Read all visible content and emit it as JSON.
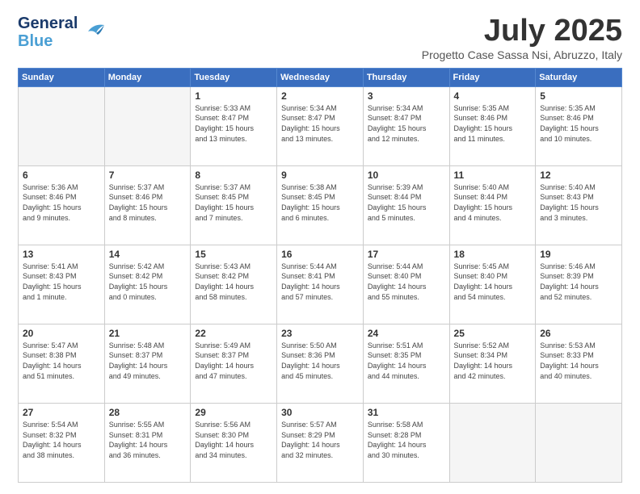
{
  "logo": {
    "line1": "General",
    "line2": "Blue"
  },
  "header": {
    "month": "July 2025",
    "subtitle": "Progetto Case Sassa Nsi, Abruzzo, Italy"
  },
  "weekdays": [
    "Sunday",
    "Monday",
    "Tuesday",
    "Wednesday",
    "Thursday",
    "Friday",
    "Saturday"
  ],
  "weeks": [
    [
      {
        "day": "",
        "info": ""
      },
      {
        "day": "",
        "info": ""
      },
      {
        "day": "1",
        "info": "Sunrise: 5:33 AM\nSunset: 8:47 PM\nDaylight: 15 hours\nand 13 minutes."
      },
      {
        "day": "2",
        "info": "Sunrise: 5:34 AM\nSunset: 8:47 PM\nDaylight: 15 hours\nand 13 minutes."
      },
      {
        "day": "3",
        "info": "Sunrise: 5:34 AM\nSunset: 8:47 PM\nDaylight: 15 hours\nand 12 minutes."
      },
      {
        "day": "4",
        "info": "Sunrise: 5:35 AM\nSunset: 8:46 PM\nDaylight: 15 hours\nand 11 minutes."
      },
      {
        "day": "5",
        "info": "Sunrise: 5:35 AM\nSunset: 8:46 PM\nDaylight: 15 hours\nand 10 minutes."
      }
    ],
    [
      {
        "day": "6",
        "info": "Sunrise: 5:36 AM\nSunset: 8:46 PM\nDaylight: 15 hours\nand 9 minutes."
      },
      {
        "day": "7",
        "info": "Sunrise: 5:37 AM\nSunset: 8:46 PM\nDaylight: 15 hours\nand 8 minutes."
      },
      {
        "day": "8",
        "info": "Sunrise: 5:37 AM\nSunset: 8:45 PM\nDaylight: 15 hours\nand 7 minutes."
      },
      {
        "day": "9",
        "info": "Sunrise: 5:38 AM\nSunset: 8:45 PM\nDaylight: 15 hours\nand 6 minutes."
      },
      {
        "day": "10",
        "info": "Sunrise: 5:39 AM\nSunset: 8:44 PM\nDaylight: 15 hours\nand 5 minutes."
      },
      {
        "day": "11",
        "info": "Sunrise: 5:40 AM\nSunset: 8:44 PM\nDaylight: 15 hours\nand 4 minutes."
      },
      {
        "day": "12",
        "info": "Sunrise: 5:40 AM\nSunset: 8:43 PM\nDaylight: 15 hours\nand 3 minutes."
      }
    ],
    [
      {
        "day": "13",
        "info": "Sunrise: 5:41 AM\nSunset: 8:43 PM\nDaylight: 15 hours\nand 1 minute."
      },
      {
        "day": "14",
        "info": "Sunrise: 5:42 AM\nSunset: 8:42 PM\nDaylight: 15 hours\nand 0 minutes."
      },
      {
        "day": "15",
        "info": "Sunrise: 5:43 AM\nSunset: 8:42 PM\nDaylight: 14 hours\nand 58 minutes."
      },
      {
        "day": "16",
        "info": "Sunrise: 5:44 AM\nSunset: 8:41 PM\nDaylight: 14 hours\nand 57 minutes."
      },
      {
        "day": "17",
        "info": "Sunrise: 5:44 AM\nSunset: 8:40 PM\nDaylight: 14 hours\nand 55 minutes."
      },
      {
        "day": "18",
        "info": "Sunrise: 5:45 AM\nSunset: 8:40 PM\nDaylight: 14 hours\nand 54 minutes."
      },
      {
        "day": "19",
        "info": "Sunrise: 5:46 AM\nSunset: 8:39 PM\nDaylight: 14 hours\nand 52 minutes."
      }
    ],
    [
      {
        "day": "20",
        "info": "Sunrise: 5:47 AM\nSunset: 8:38 PM\nDaylight: 14 hours\nand 51 minutes."
      },
      {
        "day": "21",
        "info": "Sunrise: 5:48 AM\nSunset: 8:37 PM\nDaylight: 14 hours\nand 49 minutes."
      },
      {
        "day": "22",
        "info": "Sunrise: 5:49 AM\nSunset: 8:37 PM\nDaylight: 14 hours\nand 47 minutes."
      },
      {
        "day": "23",
        "info": "Sunrise: 5:50 AM\nSunset: 8:36 PM\nDaylight: 14 hours\nand 45 minutes."
      },
      {
        "day": "24",
        "info": "Sunrise: 5:51 AM\nSunset: 8:35 PM\nDaylight: 14 hours\nand 44 minutes."
      },
      {
        "day": "25",
        "info": "Sunrise: 5:52 AM\nSunset: 8:34 PM\nDaylight: 14 hours\nand 42 minutes."
      },
      {
        "day": "26",
        "info": "Sunrise: 5:53 AM\nSunset: 8:33 PM\nDaylight: 14 hours\nand 40 minutes."
      }
    ],
    [
      {
        "day": "27",
        "info": "Sunrise: 5:54 AM\nSunset: 8:32 PM\nDaylight: 14 hours\nand 38 minutes."
      },
      {
        "day": "28",
        "info": "Sunrise: 5:55 AM\nSunset: 8:31 PM\nDaylight: 14 hours\nand 36 minutes."
      },
      {
        "day": "29",
        "info": "Sunrise: 5:56 AM\nSunset: 8:30 PM\nDaylight: 14 hours\nand 34 minutes."
      },
      {
        "day": "30",
        "info": "Sunrise: 5:57 AM\nSunset: 8:29 PM\nDaylight: 14 hours\nand 32 minutes."
      },
      {
        "day": "31",
        "info": "Sunrise: 5:58 AM\nSunset: 8:28 PM\nDaylight: 14 hours\nand 30 minutes."
      },
      {
        "day": "",
        "info": ""
      },
      {
        "day": "",
        "info": ""
      }
    ]
  ]
}
